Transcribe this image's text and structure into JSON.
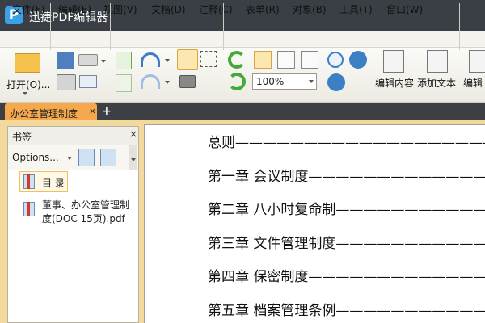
{
  "window": {
    "title": "迅捷PDF编辑器",
    "logo_letter": "P"
  },
  "menu": {
    "items": [
      "文件(F)",
      "编辑(E)",
      "视图(V)",
      "文档(D)",
      "注释(C)",
      "表单(R)",
      "对象(B)",
      "工具(T)",
      "窗口(W)"
    ]
  },
  "toolbar": {
    "open_label": "打开(O)...",
    "zoom_value": "100%",
    "edit_content_label": "编辑内容",
    "add_text_label": "添加文本",
    "edit_more_label": "编辑"
  },
  "tabs": {
    "doc_label": "办公室管理制度",
    "close_glyph": "×",
    "add_glyph": "+"
  },
  "bookmarks": {
    "title": "书签",
    "close_glyph": "×",
    "options_label": "Options...",
    "items": [
      {
        "label": "目 录"
      },
      {
        "label_line1": "董事、办公室管理制",
        "label_line2": "度(DOC 15页).pdf"
      }
    ]
  },
  "document": {
    "lines": [
      "总则————————————————————————",
      "第一章  会议制度——————————————————",
      "第二章  八小时复命制————————————————",
      "第三章  文件管理制度—————————————————",
      "第四章  保密制度———————————————————",
      "第五章  档案管理条例————————————————"
    ]
  },
  "colors": {
    "titlebar": "#3a3f45",
    "tab_active": "#f5a94c",
    "workspace": "#f3d99c",
    "logo": "#3aa0e8"
  }
}
